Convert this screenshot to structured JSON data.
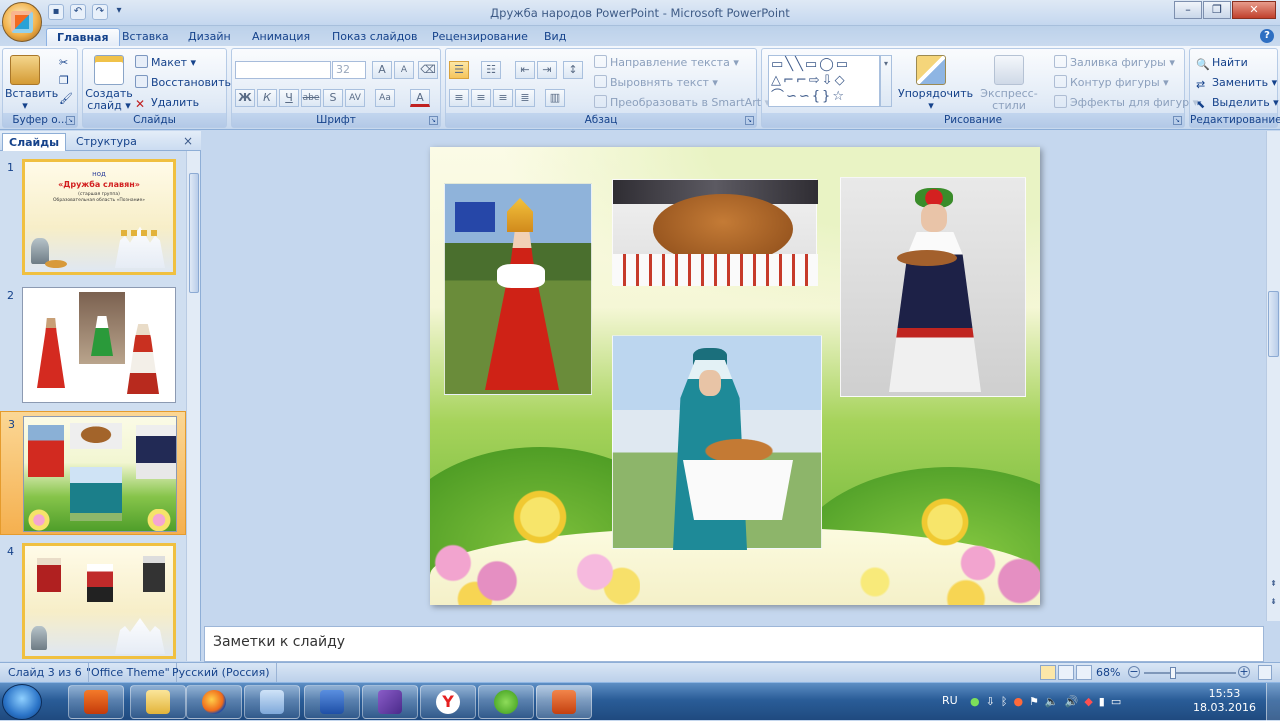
{
  "window": {
    "title": "Дружба народов PowerPoint - Microsoft PowerPoint",
    "controls": [
      "–",
      "❐",
      "✕"
    ]
  },
  "tabs": [
    "Главная",
    "Вставка",
    "Дизайн",
    "Анимация",
    "Показ слайдов",
    "Рецензирование",
    "Вид"
  ],
  "ribbon": {
    "clipboard": {
      "label": "Буфер о...",
      "paste": "Вставить"
    },
    "slides": {
      "label": "Слайды",
      "create": "Создать слайд",
      "layout": "Макет",
      "reset": "Восстановить",
      "delete": "Удалить"
    },
    "font": {
      "label": "Шрифт",
      "size": "32",
      "bold": "Ж",
      "italic": "К",
      "underline": "Ч",
      "strike": "abe",
      "shadow": "S",
      "spacing": "AV",
      "case": "Aa",
      "color": "A",
      "grow": "A",
      "shrink": "A"
    },
    "paragraph": {
      "label": "Абзац",
      "direction": "Направление текста",
      "align": "Выровнять текст",
      "smartart": "Преобразовать в SmartArt"
    },
    "drawing": {
      "label": "Рисование",
      "arrange": "Упорядочить",
      "quickstyles": "Экспресс-стили",
      "fill": "Заливка фигуры",
      "outline": "Контур фигуры",
      "effects": "Эффекты для фигур"
    },
    "editing": {
      "label": "Редактирование",
      "find": "Найти",
      "replace": "Заменить",
      "select": "Выделить"
    }
  },
  "panel": {
    "tab_slides": "Слайды",
    "tab_outline": "Структура",
    "close": "×"
  },
  "thumbnails": [
    {
      "num": "1",
      "title_small": "нод",
      "title": "«Дружба славян»",
      "subtitle": "(старшая группа)",
      "author": "Образовательная область «Познание»"
    },
    {
      "num": "2"
    },
    {
      "num": "3"
    },
    {
      "num": "4"
    }
  ],
  "notes_placeholder": "Заметки к слайду",
  "status": {
    "slide": "Слайд 3 из 6",
    "theme": "\"Office Theme\"",
    "language": "Русский (Россия)",
    "zoom": "68%"
  },
  "taskbar": {
    "lang": "RU",
    "time": "15:53",
    "date": "18.03.2016"
  }
}
